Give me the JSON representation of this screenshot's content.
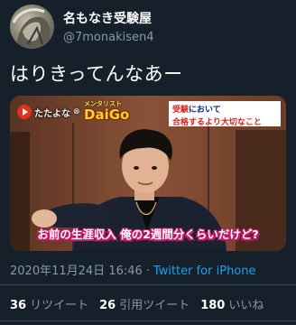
{
  "tweet": {
    "display_name": "名もなき受験屋",
    "handle": "@7monakisen4",
    "text": "はりきってんなあー",
    "timestamp": "2020年11月24日 16:46",
    "separator": "·",
    "source": "Twitter for iPhone"
  },
  "media": {
    "logo_text": "たたよな",
    "logo_x": "⊗",
    "guest_title": "メンタリスト",
    "guest_name": "DaiGo",
    "note_highlight": "受験",
    "note_line1_rest": "において",
    "note_line2": "合格するより大切なこと",
    "caption": "お前の生涯収入 俺の2週間分くらいだけど?"
  },
  "stats": [
    {
      "count": "36",
      "label": "リツイート"
    },
    {
      "count": "26",
      "label": "引用ツイート"
    },
    {
      "count": "180",
      "label": "いいね"
    }
  ],
  "colors": {
    "background": "#15202b",
    "secondary_text": "#8899a6",
    "link": "#1da1f2",
    "divider": "#38444d"
  }
}
